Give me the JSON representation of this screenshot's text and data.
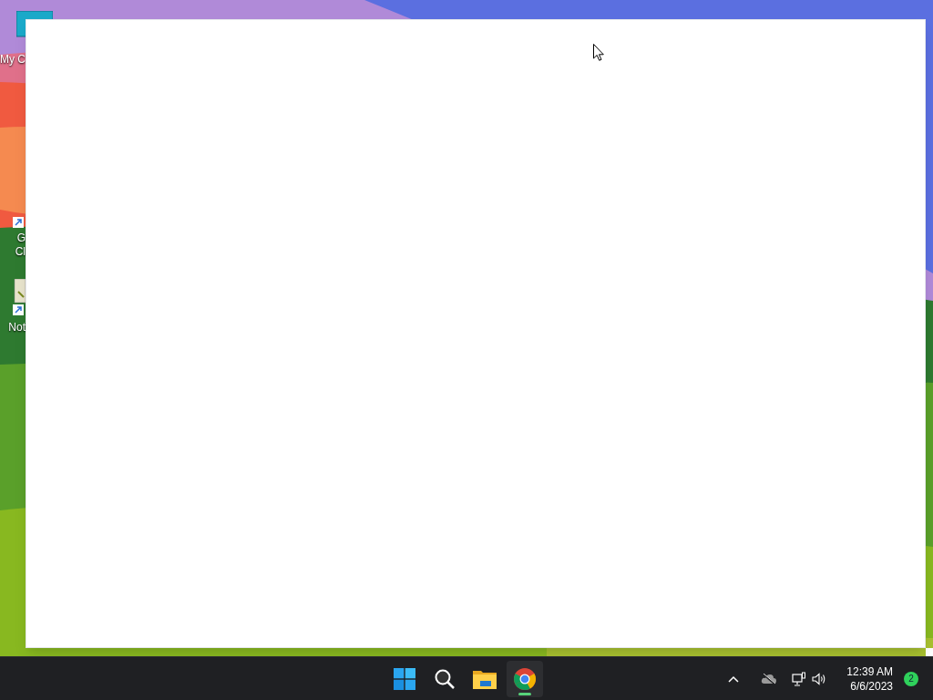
{
  "desktop": {
    "icons": [
      {
        "kind": "computer",
        "lines": [
          "My C"
        ]
      },
      {
        "kind": "chrome-shortcut",
        "lines": [
          "G",
          "Cl"
        ]
      },
      {
        "kind": "notepad-shortcut",
        "lines": [
          "Not"
        ]
      }
    ]
  },
  "taskbar": {
    "apps": [
      {
        "kind": "start",
        "selected": false
      },
      {
        "kind": "search",
        "selected": false
      },
      {
        "kind": "files",
        "selected": false
      },
      {
        "kind": "chrome",
        "selected": true
      }
    ],
    "tray": {
      "time": "12:39 AM",
      "date": "6/6/2023",
      "notifications": "2"
    }
  }
}
